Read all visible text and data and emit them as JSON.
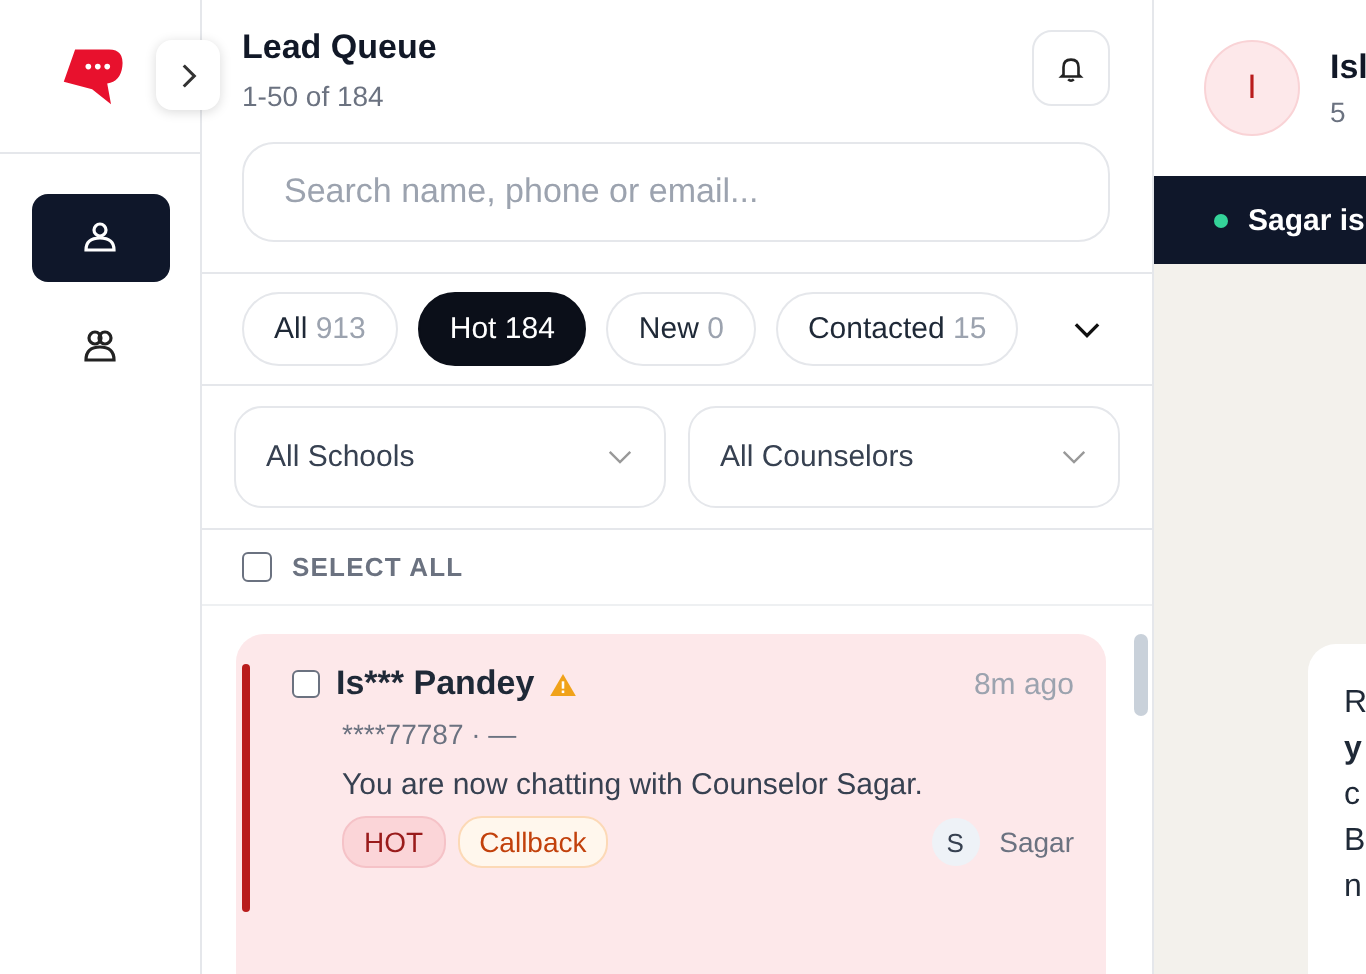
{
  "queue": {
    "title": "Lead Queue",
    "subtitle": "1-50 of 184"
  },
  "search": {
    "placeholder": "Search name, phone or email..."
  },
  "tabs": [
    {
      "label": "All",
      "count": "913",
      "selected": false
    },
    {
      "label": "Hot",
      "count": "184",
      "selected": true
    },
    {
      "label": "New",
      "count": "0",
      "selected": false
    },
    {
      "label": "Contacted",
      "count": "15",
      "selected": false
    }
  ],
  "filters": [
    {
      "value": "All Schools"
    },
    {
      "value": "All Counselors"
    }
  ],
  "select_all": {
    "label": "SELECT ALL",
    "checked": false
  },
  "leads": [
    {
      "name": "Is*** Pandey",
      "warning": true,
      "time": "8m ago",
      "contact": "****77787 · —",
      "message": "You are now chatting with Counselor Sagar.",
      "checked": false,
      "tags": [
        {
          "label": "HOT",
          "kind": "hot"
        },
        {
          "label": "Callback",
          "kind": "callback"
        }
      ],
      "counselor_initial": "S",
      "counselor": "Sagar"
    }
  ],
  "nav": [
    {
      "kind": "person",
      "selected": true
    },
    {
      "kind": "people",
      "selected": false
    }
  ],
  "chat": {
    "avatar": "I",
    "name": "Isl",
    "meta": "5",
    "banner": "Sagar is",
    "message_lines": [
      {
        "text": "R",
        "bold": false
      },
      {
        "text": "y",
        "bold": true
      },
      {
        "text": "c",
        "bold": false
      },
      {
        "text": "B",
        "bold": false
      },
      {
        "text": "n",
        "bold": false
      }
    ]
  }
}
